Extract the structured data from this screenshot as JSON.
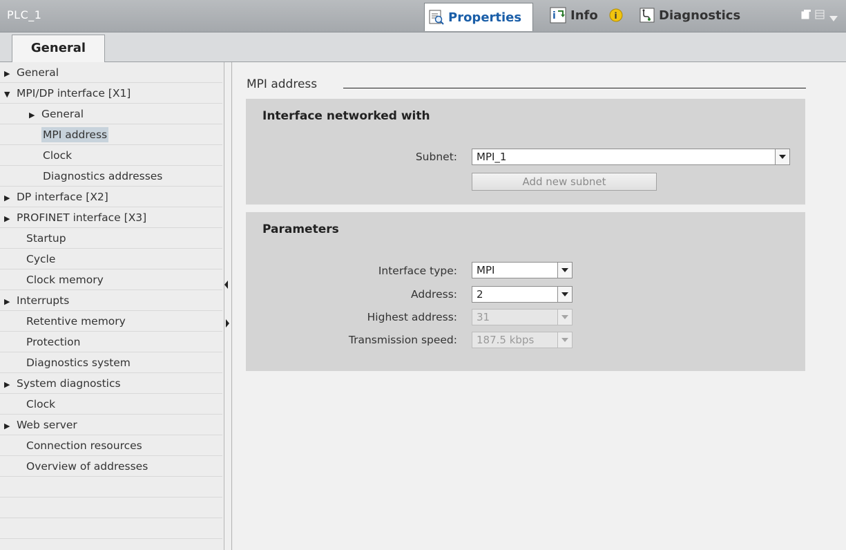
{
  "window": {
    "title": "PLC_1",
    "tabs": [
      {
        "label": "Properties",
        "icon": "properties-icon",
        "active": true
      },
      {
        "label": "Info",
        "icon": "info-icon",
        "active": false
      },
      {
        "label": "Diagnostics",
        "icon": "diagnostics-icon",
        "active": false
      }
    ],
    "info_badge_icon": "info-badge-icon"
  },
  "subtab": {
    "label": "General"
  },
  "nav": {
    "items": [
      {
        "label": "General",
        "expander": "collapsed",
        "indent": 0
      },
      {
        "label": "MPI/DP interface [X1]",
        "expander": "expanded",
        "indent": 0
      },
      {
        "label": "General",
        "expander": "collapsed",
        "indent": 1
      },
      {
        "label": "MPI address",
        "expander": "none",
        "indent": 2,
        "selected": true
      },
      {
        "label": "Clock",
        "expander": "none",
        "indent": 2
      },
      {
        "label": "Diagnostics addresses",
        "expander": "none",
        "indent": 2
      },
      {
        "label": "DP interface [X2]",
        "expander": "collapsed",
        "indent": 0
      },
      {
        "label": "PROFINET interface [X3]",
        "expander": "collapsed",
        "indent": 0
      },
      {
        "label": "Startup",
        "expander": "none",
        "indent": 0
      },
      {
        "label": "Cycle",
        "expander": "none",
        "indent": 0
      },
      {
        "label": "Clock memory",
        "expander": "none",
        "indent": 0
      },
      {
        "label": "Interrupts",
        "expander": "collapsed",
        "indent": 0
      },
      {
        "label": "Retentive memory",
        "expander": "none",
        "indent": 0
      },
      {
        "label": "Protection",
        "expander": "none",
        "indent": 0
      },
      {
        "label": "Diagnostics system",
        "expander": "none",
        "indent": 0
      },
      {
        "label": "System diagnostics",
        "expander": "collapsed",
        "indent": 0
      },
      {
        "label": "Clock",
        "expander": "none",
        "indent": 0
      },
      {
        "label": "Web server",
        "expander": "collapsed",
        "indent": 0
      },
      {
        "label": "Connection resources",
        "expander": "none",
        "indent": 0
      },
      {
        "label": "Overview of addresses",
        "expander": "none",
        "indent": 0
      },
      {
        "label": "",
        "expander": "none",
        "indent": 0
      },
      {
        "label": "",
        "expander": "none",
        "indent": 0
      },
      {
        "label": "",
        "expander": "none",
        "indent": 0
      }
    ]
  },
  "content": {
    "section_title": "MPI address",
    "interface_group": {
      "title": "Interface networked with",
      "subnet_label": "Subnet:",
      "subnet_value": "MPI_1",
      "add_button_label": "Add new subnet"
    },
    "parameters_group": {
      "title": "Parameters",
      "fields": [
        {
          "label": "Interface type:",
          "value": "MPI",
          "enabled": true
        },
        {
          "label": "Address:",
          "value": "2",
          "enabled": true
        },
        {
          "label": "Highest address:",
          "value": "31",
          "enabled": false
        },
        {
          "label": "Transmission speed:",
          "value": "187.5 kbps",
          "enabled": false
        }
      ]
    }
  },
  "colors": {
    "titlebar": "#a9adb1",
    "active_tab_text": "#1a5ea8",
    "selection": "#c8d3dc",
    "group_bg": "#d4d4d4"
  }
}
